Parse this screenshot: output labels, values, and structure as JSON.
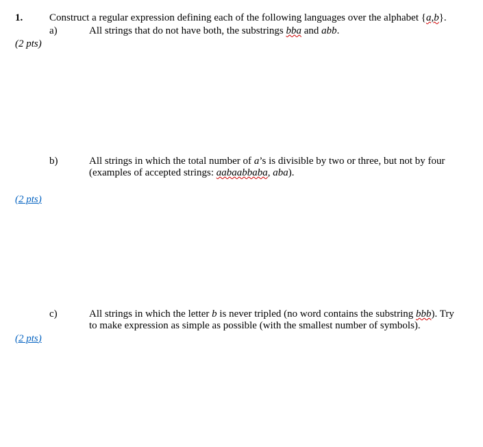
{
  "q1": {
    "number": "1.",
    "prompt_pre": "Construct a regular expression defining each of the following languages over the alphabet {",
    "prompt_ab": "a,b",
    "prompt_post": "}.",
    "a": {
      "label": "a)",
      "pts": "(2 pts)",
      "text_pre": "All strings that do not have both, the substrings ",
      "bba": "bba",
      "text_mid": " and ",
      "abb": "abb",
      "text_post": "."
    },
    "b": {
      "label": "b)",
      "pts_open": "(2",
      "pts_link": " pts",
      "pts_close": ")",
      "text_pre": "All strings in which the total number of ",
      "a": "a",
      "text_mid1": "’s is divisible by two or three, but not by four (examples of accepted strings: ",
      "ex1": "aabaabbaba",
      "comma": ", ",
      "ex2": "aba",
      "text_post": ")."
    },
    "c": {
      "label": "c)",
      "pts_open": "(2",
      "pts_link": " pts",
      "pts_close": ")",
      "text_pre": "All strings in which the letter ",
      "b": "b",
      "text_mid": " is never tripled (no word contains the substring ",
      "bbb": "bbb",
      "text_post1": "). Try to make expression as simple as possible (with the smallest number of symbols)."
    }
  }
}
